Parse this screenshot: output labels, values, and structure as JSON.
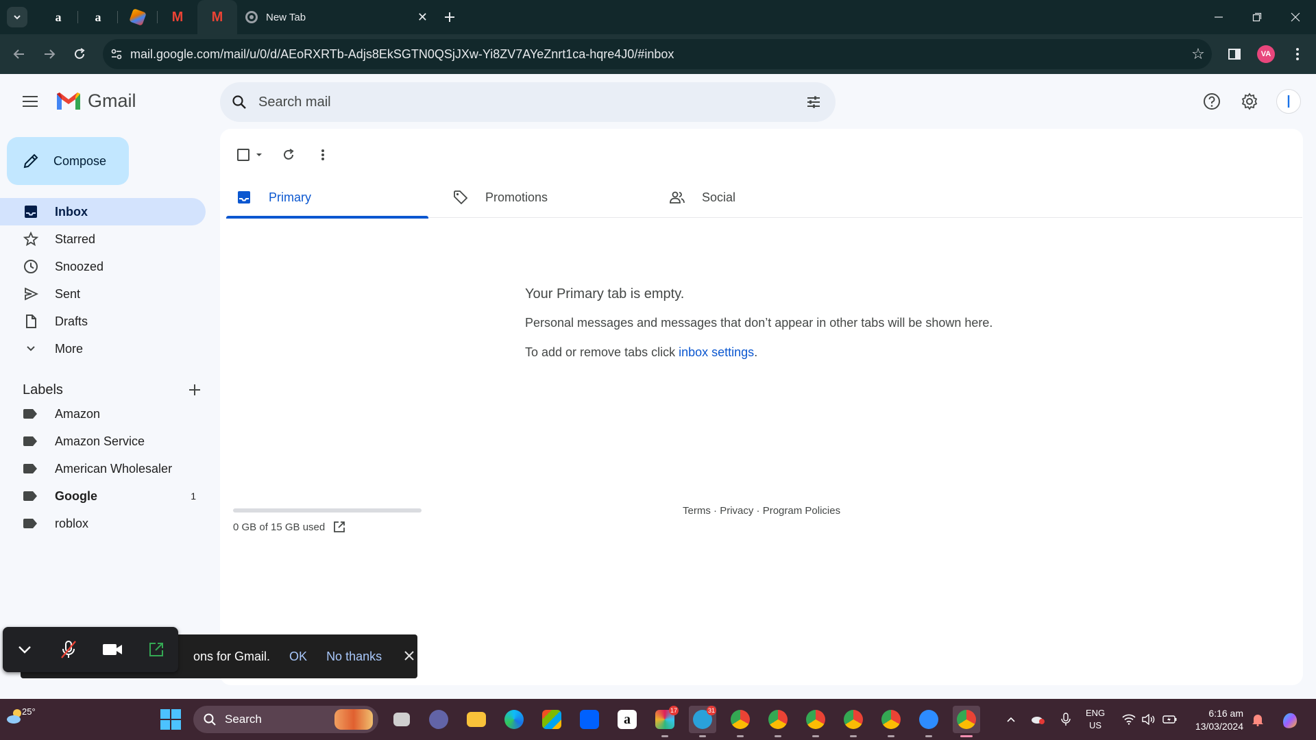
{
  "browser": {
    "new_tab_label": "New Tab",
    "url": "mail.google.com/mail/u/0/d/AEoRXRTb-Adjs8EkSGTN0QSjJXw-Yi8ZV7AYeZnrt1ca-hqre4J0/#inbox",
    "profile_initials": "VA"
  },
  "gmail": {
    "logo_text": "Gmail",
    "search_placeholder": "Search mail",
    "compose_label": "Compose",
    "nav": [
      {
        "label": "Inbox",
        "icon": "inbox-icon"
      },
      {
        "label": "Starred",
        "icon": "star-icon"
      },
      {
        "label": "Snoozed",
        "icon": "clock-icon"
      },
      {
        "label": "Sent",
        "icon": "send-icon"
      },
      {
        "label": "Drafts",
        "icon": "draft-icon"
      },
      {
        "label": "More",
        "icon": "chevron-down-icon"
      }
    ],
    "labels_title": "Labels",
    "labels": [
      {
        "name": "Amazon"
      },
      {
        "name": "Amazon Service"
      },
      {
        "name": "American Wholesaler"
      },
      {
        "name": "Google",
        "count": "1"
      },
      {
        "name": "roblox"
      }
    ],
    "tabs": [
      {
        "label": "Primary"
      },
      {
        "label": "Promotions"
      },
      {
        "label": "Social"
      }
    ],
    "empty": {
      "title": "Your Primary tab is empty.",
      "line1": "Personal messages and messages that don’t appear in other tabs will be shown here.",
      "line2_prefix": "To add or remove tabs click ",
      "line2_link": "inbox settings",
      "line2_suffix": "."
    },
    "storage_text": "0 GB of 15 GB used",
    "storage_fraction": 0.0,
    "footer": {
      "terms": "Terms",
      "privacy": "Privacy",
      "policies": "Program Policies",
      "sep": " · "
    }
  },
  "snackbar": {
    "message": "ons for Gmail.",
    "ok": "OK",
    "no_thanks": "No thanks"
  },
  "taskbar": {
    "temperature": "25°",
    "search_label": "Search",
    "lang_line1": "ENG",
    "lang_line2": "US",
    "time": "6:16 am",
    "date": "13/03/2024",
    "badges": {
      "slack": "17",
      "telegram": "31"
    }
  },
  "colors": {
    "accent": "#0b57d0",
    "compose_bg": "#c2e7ff",
    "active_nav_bg": "#d3e3fd",
    "browser_frame": "#12282b",
    "taskbar": "#3d2531"
  }
}
